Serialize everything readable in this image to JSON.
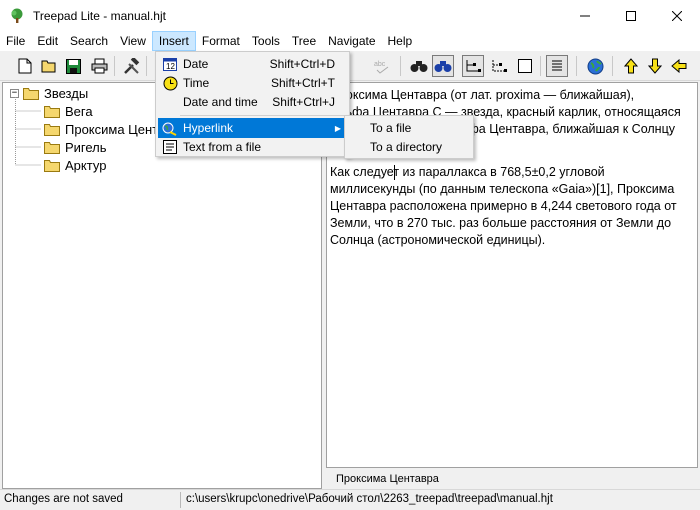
{
  "window": {
    "title": "Treepad Lite - manual.hjt"
  },
  "menubar": {
    "items": [
      "File",
      "Edit",
      "Search",
      "View",
      "Insert",
      "Format",
      "Tools",
      "Tree",
      "Navigate",
      "Help"
    ]
  },
  "tree": {
    "root": "Звезды",
    "children": [
      "Вега",
      "Проксима Центавра",
      "Ригель",
      "Арктур"
    ]
  },
  "note": {
    "line1": "Проксима Центавра (от лат. proxima — ближайшая),",
    "line2": "Альфа Центавра C — звезда, красный карлик, относящаяся",
    "line3": "к звёздной системе Альфа Центавра, ближайшая к Солнцу",
    "line4": "звезда.",
    "para2_l1": "Как следует из параллакса в 768,5±0,2 угловой",
    "para2_l2": "миллисекунды (по данным телескопа «Gaia»)[1], Проксима",
    "para2_l3": "Центавра расположена примерно в 4,244 светового года от",
    "para2_l4": "Земли, что в 270 тыс. раз больше расстояния от Земли до",
    "para2_l5": "Солнца (астрономической единицы)."
  },
  "pane_label": "Проксима Центавра",
  "status": {
    "left": "Changes are not saved",
    "right": "c:\\users\\krupc\\onedrive\\Рабочий стол\\2263_treepad\\treepad\\manual.hjt"
  },
  "insert_menu": {
    "items": [
      {
        "label": "Date",
        "shortcut": "Shift+Ctrl+D",
        "icon": "calendar-icon"
      },
      {
        "label": "Time",
        "shortcut": "Shift+Ctrl+T",
        "icon": "clock-icon"
      },
      {
        "label": "Date and time",
        "shortcut": "Shift+Ctrl+J",
        "icon": ""
      },
      {
        "label": "Hyperlink",
        "shortcut": "",
        "icon": "hyperlink-icon",
        "has_submenu": true
      },
      {
        "label": "Text from a file",
        "shortcut": "",
        "icon": "text-file-icon"
      }
    ]
  },
  "hyperlink_submenu": {
    "items": [
      "To a file",
      "To a directory"
    ]
  },
  "colors": {
    "highlight": "#0078d7",
    "menu_active": "#cce8ff",
    "folder": "#f5d76e"
  }
}
